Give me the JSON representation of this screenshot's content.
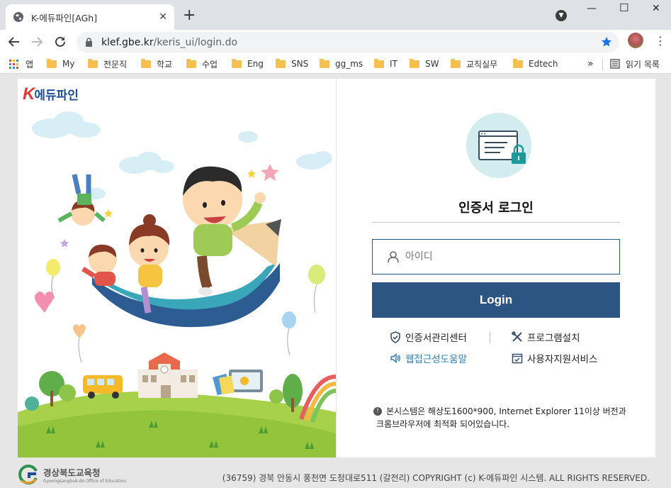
{
  "browser": {
    "tab_title": "K-에듀파인[AGh]",
    "new_tab": "+",
    "url_domain": "klef.gbe.kr",
    "url_path": "/keris_ui/login.do",
    "bookmarks": [
      {
        "label": "앱",
        "type": "apps"
      },
      {
        "label": "My",
        "type": "folder"
      },
      {
        "label": "전문직",
        "type": "folder"
      },
      {
        "label": "학교",
        "type": "folder"
      },
      {
        "label": "수업",
        "type": "folder"
      },
      {
        "label": "Eng",
        "type": "folder"
      },
      {
        "label": "SNS",
        "type": "folder"
      },
      {
        "label": "gg_ms",
        "type": "folder"
      },
      {
        "label": "IT",
        "type": "folder"
      },
      {
        "label": "SW",
        "type": "folder"
      },
      {
        "label": "교직실무",
        "type": "folder"
      },
      {
        "label": "Edtech",
        "type": "folder"
      }
    ],
    "more": "»",
    "reading_list": "읽기 목록"
  },
  "brand": {
    "logo_k": "K",
    "logo_text": "에듀파인"
  },
  "login": {
    "title": "인증서 로그인",
    "id_placeholder": "아이디",
    "id_value": "",
    "button_label": "Login"
  },
  "links": {
    "cert_center": "인증서관리센터",
    "program_install": "프로그램설치",
    "accessibility": "웹접근성도움말",
    "user_support": "사용자지원서비스"
  },
  "notice": {
    "line1": "본시스템은 해상도1600*900, Internet Explorer 11이상 버전과",
    "line2": "크롬브라우저에 최적화 되어있습니다."
  },
  "footer": {
    "org_name": "경상북도교육청",
    "org_name_en": "Gyeongsangbuk-do Office of Education",
    "address": "(36759) 경북 안동시 풍천면 도청대로511 (갈전리)  COPYRIGHT (c) K-에듀파인 시스템.  ALL RIGHTS RESERVED."
  },
  "colors": {
    "primary": "#2c5584",
    "accent_red": "#e03a3a",
    "link_blue": "#2f7fb0",
    "lock_bg": "#d3ecef"
  }
}
